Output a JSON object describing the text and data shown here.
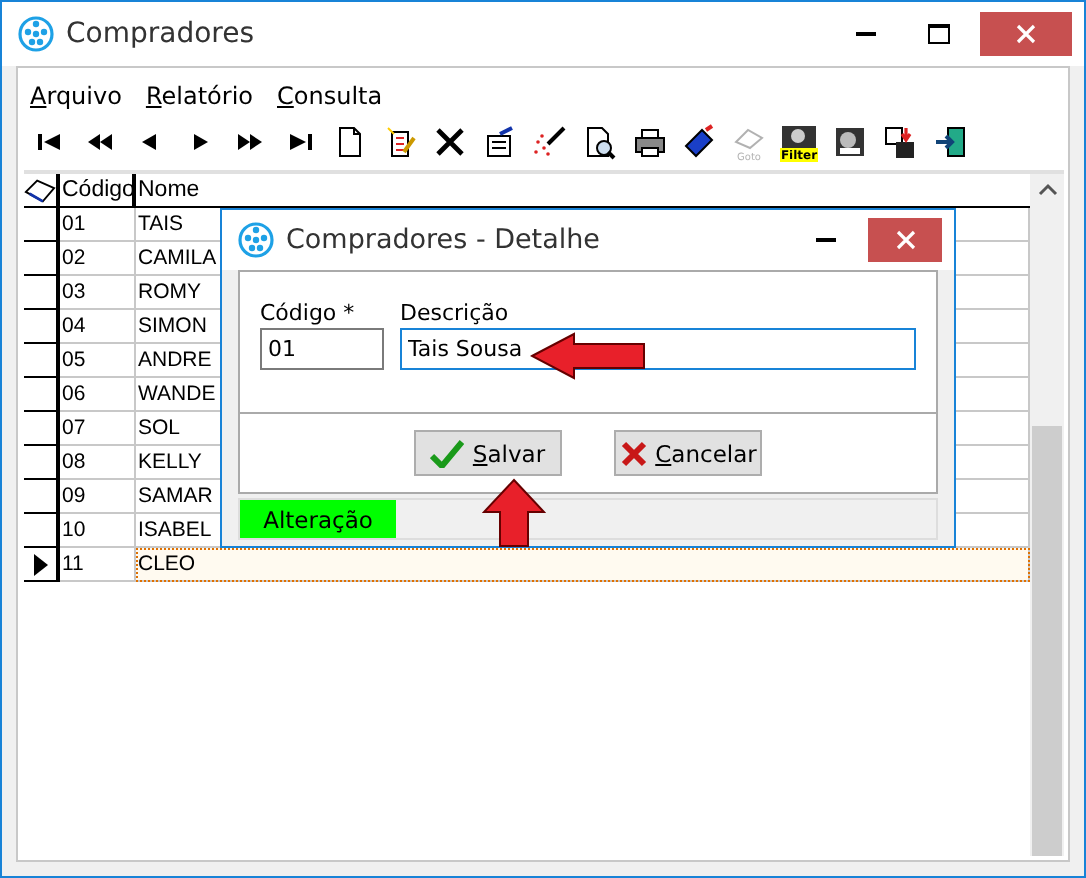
{
  "window": {
    "title": "Compradores"
  },
  "menu": [
    "Arquivo",
    "Relatório",
    "Consulta"
  ],
  "toolbar": [
    {
      "kind": "first"
    },
    {
      "kind": "prev-page"
    },
    {
      "kind": "prev"
    },
    {
      "kind": "next"
    },
    {
      "kind": "next-page"
    },
    {
      "kind": "last"
    },
    {
      "kind": "new"
    },
    {
      "kind": "edit"
    },
    {
      "kind": "delete"
    },
    {
      "kind": "properties"
    },
    {
      "kind": "wand"
    },
    {
      "kind": "preview"
    },
    {
      "kind": "print"
    },
    {
      "kind": "tag"
    },
    {
      "kind": "goto",
      "label": "Goto",
      "disabled": true
    },
    {
      "kind": "filter",
      "label": "Filter"
    },
    {
      "kind": "monitor"
    },
    {
      "kind": "save"
    },
    {
      "kind": "exit"
    }
  ],
  "grid": {
    "columns": [
      "Código",
      "Nome"
    ],
    "rows": [
      {
        "codigo": "01",
        "nome": "TAIS",
        "selected": false
      },
      {
        "codigo": "02",
        "nome": "CAMILA",
        "selected": false
      },
      {
        "codigo": "03",
        "nome": "ROMY",
        "selected": false
      },
      {
        "codigo": "04",
        "nome": "SIMON",
        "selected": false
      },
      {
        "codigo": "05",
        "nome": "ANDRE",
        "selected": false
      },
      {
        "codigo": "06",
        "nome": "WANDE",
        "selected": false
      },
      {
        "codigo": "07",
        "nome": "SOL",
        "selected": false
      },
      {
        "codigo": "08",
        "nome": "KELLY",
        "selected": false
      },
      {
        "codigo": "09",
        "nome": "SAMAR",
        "selected": false
      },
      {
        "codigo": "10",
        "nome": "ISABEL",
        "selected": false
      },
      {
        "codigo": "11",
        "nome": "CLEO",
        "selected": true
      }
    ]
  },
  "dialog": {
    "title": "Compradores - Detalhe",
    "fields": [
      {
        "label": "Código *",
        "value": "01"
      },
      {
        "label": "Descrição",
        "value": "Tais Sousa"
      }
    ],
    "buttons": [
      {
        "kind": "save",
        "label": "Salvar"
      },
      {
        "kind": "cancel",
        "label": "Cancelar"
      }
    ],
    "status": "Alteração"
  }
}
